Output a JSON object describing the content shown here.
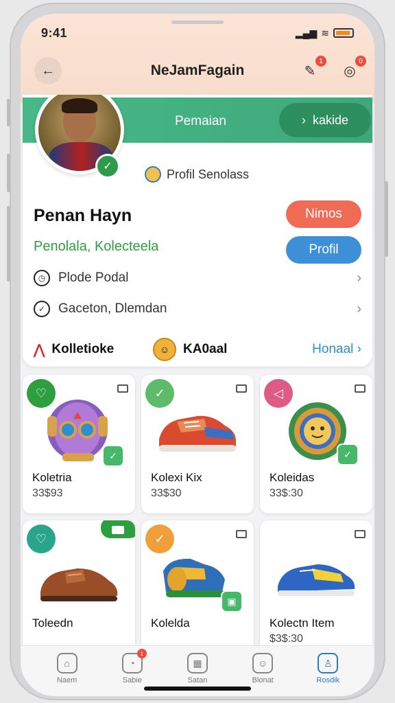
{
  "status": {
    "time": "9:41",
    "signal": "▂▄▆",
    "wifi": "≋"
  },
  "nav": {
    "back_glyph": "←",
    "title": "NeJamFagain",
    "edit_icon_glyph": "✎",
    "edit_badge": "1",
    "bell_icon_glyph": "◎",
    "bell_badge": "0"
  },
  "banner": {
    "label": "Pemaian",
    "button_label": "kakide",
    "button_chevron": "›"
  },
  "profile": {
    "tag": "Profil Senolass",
    "name": "Penan Hayn",
    "role": "Penolala, Kolecteela",
    "pill_red": "Nimos",
    "pill_blue": "Profil",
    "rows": [
      {
        "label": "Plode Podal",
        "icon": "◷"
      },
      {
        "label": "Gaceton, Dlemdan",
        "icon": "✓"
      }
    ],
    "chevron": "›",
    "stat_a_mark": "⋀",
    "stat_a": "Kolletioke",
    "stat_b_coin": "☺",
    "stat_b": "KA0aal",
    "stat_c": "Honaal ›"
  },
  "items": [
    {
      "title": "Koletria",
      "price": "33$93",
      "fav": "♡",
      "fav_color": "#2f9e3f"
    },
    {
      "title": "Kolexi Kix",
      "price": "33$30",
      "fav": "✓",
      "fav_color": "#5dbb6a"
    },
    {
      "title": "Koleidas",
      "price": "33$:30",
      "fav": "◁",
      "fav_color": "#e05a86"
    },
    {
      "title": "Toleedn",
      "price": "",
      "fav": "♡",
      "fav_color": "#2aa58a"
    },
    {
      "title": "Kolelda",
      "price": "",
      "fav": "✓",
      "fav_color": "#f0a03a"
    },
    {
      "title": "Kolectn Item",
      "price": "$3$:30",
      "fav": "",
      "fav_color": ""
    }
  ],
  "tabs": [
    {
      "label": "Naem",
      "icon": "⌂"
    },
    {
      "label": "Sabie",
      "icon": "◔",
      "badge": "1"
    },
    {
      "label": "Satan",
      "icon": "▦"
    },
    {
      "label": "Blonat",
      "icon": "☺"
    },
    {
      "label": "Rosdik",
      "icon": "♙",
      "active": true
    }
  ]
}
